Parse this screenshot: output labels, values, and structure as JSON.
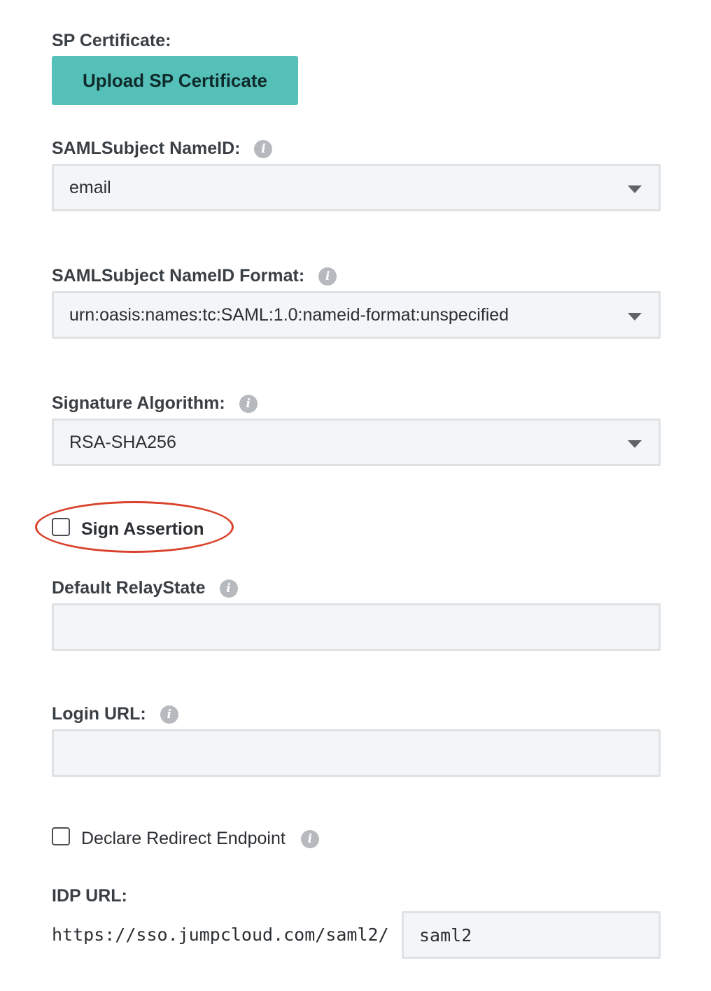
{
  "sp_certificate": {
    "label": "SP Certificate:",
    "button_label": "Upload SP Certificate"
  },
  "nameid": {
    "label": "SAMLSubject NameID:",
    "value": "email"
  },
  "nameid_format": {
    "label": "SAMLSubject NameID Format:",
    "value": "urn:oasis:names:tc:SAML:1.0:nameid-format:unspecified"
  },
  "signature_algorithm": {
    "label": "Signature Algorithm:",
    "value": "RSA-SHA256"
  },
  "sign_assertion": {
    "label": "Sign Assertion",
    "checked": false
  },
  "relay_state": {
    "label": "Default RelayState",
    "value": ""
  },
  "login_url": {
    "label": "Login URL:",
    "value": ""
  },
  "declare_redirect": {
    "label": "Declare Redirect Endpoint",
    "checked": false
  },
  "idp_url": {
    "label": "IDP URL:",
    "prefix": "https://sso.jumpcloud.com/saml2/",
    "value": "saml2"
  },
  "icons": {
    "info": "info-icon",
    "dropdown": "chevron-down-icon"
  },
  "colors": {
    "upload_button": "#55c0b8",
    "highlight": "#d9412b",
    "field_background": "#f4f5f6"
  }
}
